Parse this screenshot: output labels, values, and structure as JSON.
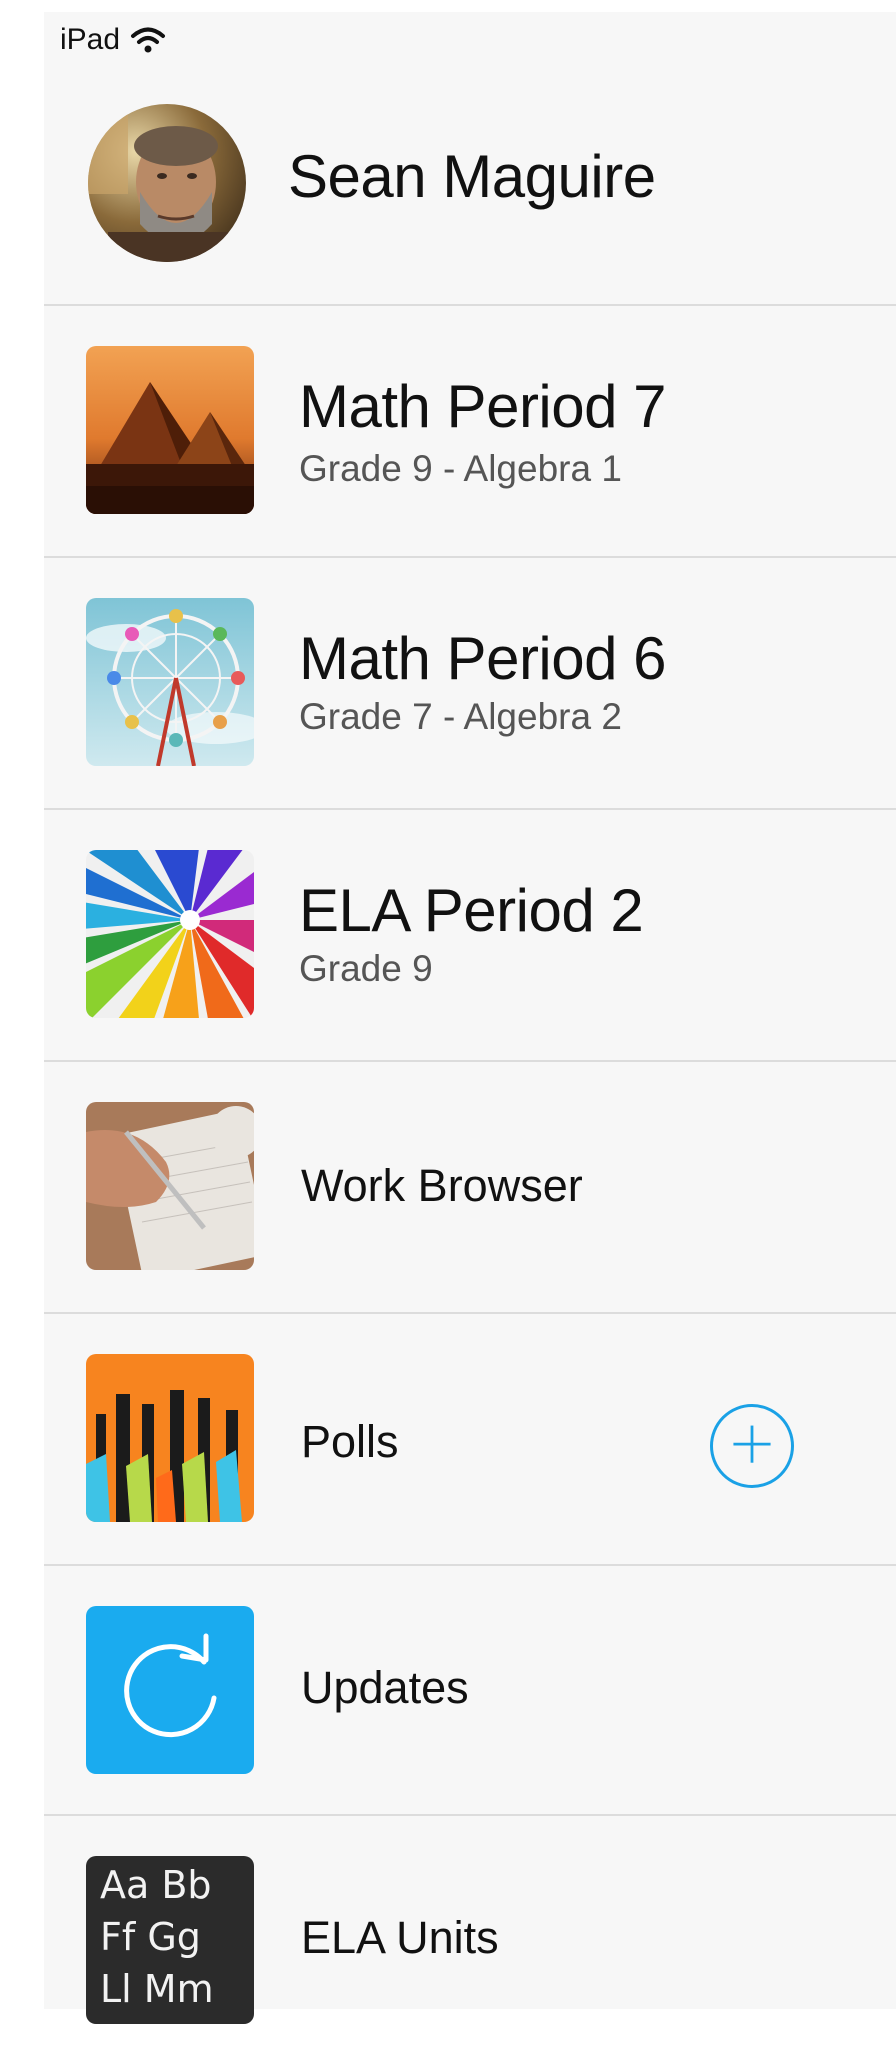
{
  "status_bar": {
    "carrier": "iPad",
    "wifi_icon": "wifi-icon"
  },
  "profile": {
    "name": "Sean Maguire",
    "avatar_icon": "avatar-photo"
  },
  "menu": {
    "classes": [
      {
        "title": "Math Period 7",
        "subtitle": "Grade 9 - Algebra 1",
        "thumb": "pyramids-image"
      },
      {
        "title": "Math Period 6",
        "subtitle": "Grade 7 - Algebra 2",
        "thumb": "ferris-wheel-image"
      },
      {
        "title": "ELA Period 2",
        "subtitle": "Grade 9",
        "thumb": "colored-pencils-image"
      }
    ],
    "tools": [
      {
        "label": "Work Browser",
        "thumb": "writing-hand-image"
      },
      {
        "label": "Polls",
        "thumb": "raised-hands-image",
        "action_icon": "plus-circle-icon"
      },
      {
        "label": "Updates",
        "thumb": "refresh-icon"
      },
      {
        "label": "ELA Units",
        "thumb": "alphabet-chalkboard-image",
        "chalk_text": [
          "Aa Bb",
          "Ff Gg",
          "Ll Mm"
        ]
      }
    ]
  },
  "colors": {
    "accent": "#1aa1e6",
    "panel_bg": "#f7f7f7",
    "divider": "#dcdcdc",
    "subtitle": "#555555"
  }
}
